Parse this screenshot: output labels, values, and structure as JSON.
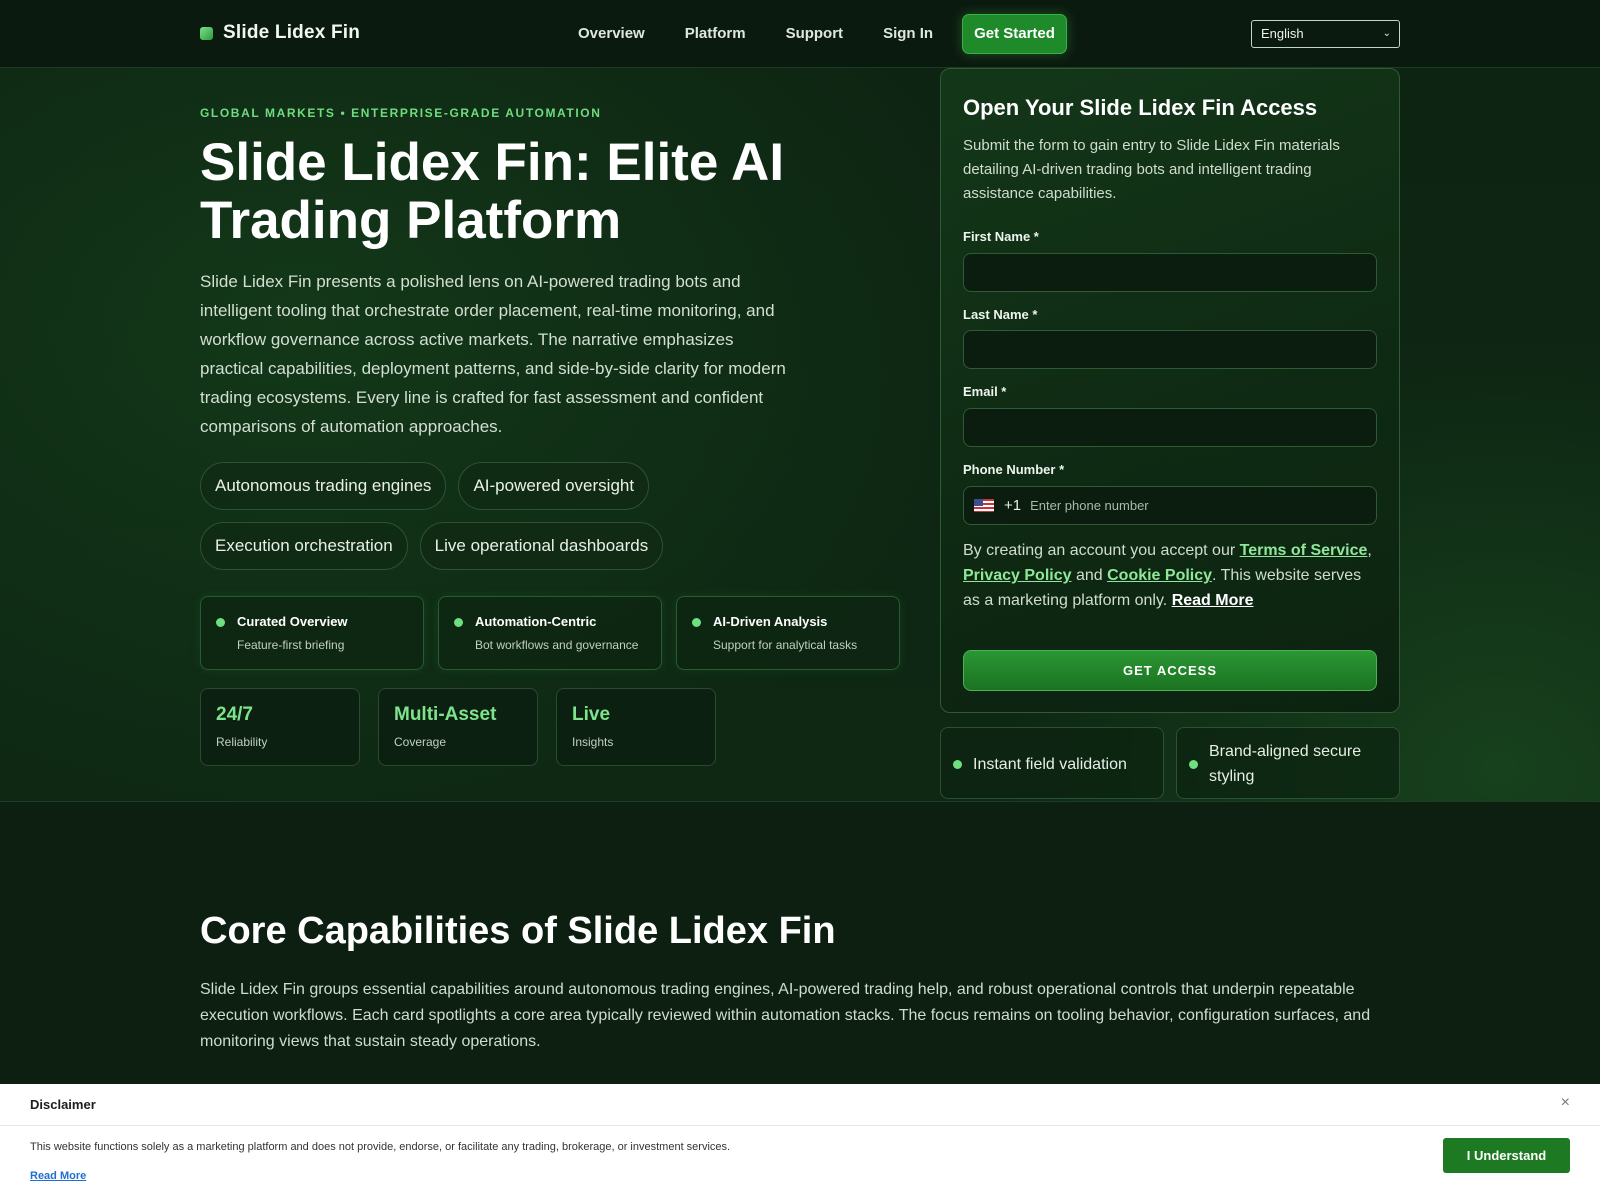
{
  "header": {
    "brand": "Slide Lidex Fin",
    "nav": [
      "Overview",
      "Platform",
      "Support",
      "Sign In"
    ],
    "cta": "Get Started",
    "language": "English"
  },
  "hero": {
    "eyebrow": "GLOBAL MARKETS • ENTERPRISE-GRADE AUTOMATION",
    "title": "Slide Lidex Fin: Elite AI Trading Platform",
    "description": "Slide Lidex Fin presents a polished lens on AI-powered trading bots and intelligent tooling that orchestrate order placement, real-time monitoring, and workflow governance across active markets. The narrative emphasizes practical capabilities, deployment patterns, and side-by-side clarity for modern trading ecosystems. Every line is crafted for fast assessment and confident comparisons of automation approaches.",
    "chips": [
      "Autonomous trading engines",
      "AI-powered oversight",
      "Execution orchestration",
      "Live operational dashboards"
    ],
    "features": [
      {
        "title": "Curated Overview",
        "subtitle": "Feature-first briefing"
      },
      {
        "title": "Automation-Centric",
        "subtitle": "Bot workflows and governance"
      },
      {
        "title": "AI-Driven Analysis",
        "subtitle": "Support for analytical tasks"
      }
    ],
    "stats": [
      {
        "value": "24/7",
        "label": "Reliability"
      },
      {
        "value": "Multi-Asset",
        "label": "Coverage"
      },
      {
        "value": "Live",
        "label": "Insights"
      }
    ]
  },
  "form": {
    "title": "Open Your Slide Lidex Fin Access",
    "description": "Submit the form to gain entry to Slide Lidex Fin materials detailing AI-driven trading bots and intelligent trading assistance capabilities.",
    "first_name_label": "First Name *",
    "last_name_label": "Last Name *",
    "email_label": "Email *",
    "phone_label": "Phone Number *",
    "dial_code": "+1",
    "phone_placeholder": "Enter phone number",
    "terms_prefix": "By creating an account you accept our ",
    "terms_link": "Terms of Service",
    "comma": ",",
    "privacy_link": "Privacy Policy",
    "and": " and ",
    "cookie_link": "Cookie Policy",
    "terms_suffix": ". This website serves as a marketing platform only. ",
    "read_more": "Read More",
    "submit": "GET ACCESS",
    "assurances": [
      "Instant field validation",
      "Brand-aligned secure styling"
    ]
  },
  "core": {
    "title": "Core Capabilities of Slide Lidex Fin",
    "description": "Slide Lidex Fin groups essential capabilities around autonomous trading engines, AI-powered trading help, and robust operational controls that underpin repeatable execution workflows. Each card spotlights a core area typically reviewed within automation stacks. The focus remains on tooling behavior, configuration surfaces, and monitoring views that sustain steady operations."
  },
  "disclaimer": {
    "title": "Disclaimer",
    "close": "×",
    "text": "This website functions solely as a marketing platform and does not provide, endorse, or facilitate any trading, brokerage, or investment services.",
    "read_more": "Read More",
    "button": "I Understand"
  },
  "colors": {
    "accent": "#6fdc7f",
    "brand_green": "#1f8a2a",
    "background": "#0c1f10"
  }
}
